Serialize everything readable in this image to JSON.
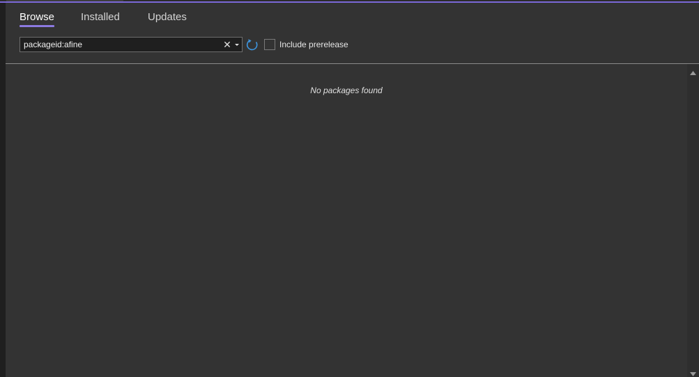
{
  "tabs": [
    {
      "label": "Browse",
      "active": true
    },
    {
      "label": "Installed",
      "active": false
    },
    {
      "label": "Updates",
      "active": false
    }
  ],
  "search": {
    "value": "packageid:afine",
    "clear_icon": "close-icon",
    "dropdown_icon": "chevron-down-icon"
  },
  "refresh_icon": "refresh-icon",
  "prerelease": {
    "label": "Include prerelease",
    "checked": false
  },
  "results": {
    "empty_message": "No packages found"
  },
  "colors": {
    "accent": "#8c7ae0",
    "panel_bg": "#333333",
    "input_bg": "#1f1f1f",
    "refresh": "#3e96e0"
  }
}
